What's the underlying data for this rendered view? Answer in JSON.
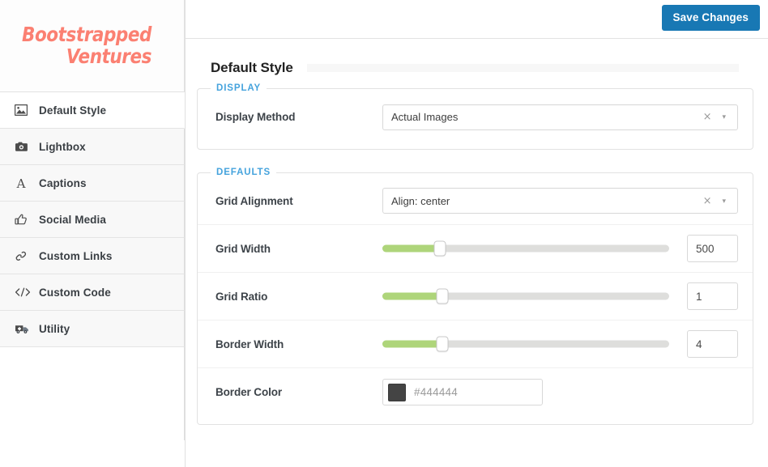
{
  "brand": {
    "line1": "Bootstrapped",
    "line2": "Ventures",
    "color": "#fb8072"
  },
  "sidebar": {
    "items": [
      {
        "label": "Default Style",
        "icon": "image-icon",
        "active": true
      },
      {
        "label": "Lightbox",
        "icon": "camera-icon",
        "active": false
      },
      {
        "label": "Captions",
        "icon": "letter-a-icon",
        "active": false
      },
      {
        "label": "Social Media",
        "icon": "thumbs-up-icon",
        "active": false
      },
      {
        "label": "Custom Links",
        "icon": "link-icon",
        "active": false
      },
      {
        "label": "Custom Code",
        "icon": "code-icon",
        "active": false
      },
      {
        "label": "Utility",
        "icon": "ambulance-icon",
        "active": false
      }
    ]
  },
  "topbar": {
    "save_label": "Save Changes",
    "save_color": "#1878b4"
  },
  "page": {
    "title": "Default Style"
  },
  "panels": [
    {
      "legend": "DISPLAY",
      "rows": [
        {
          "label": "Display Method",
          "type": "select",
          "value": "Actual Images",
          "clear_icon": "×",
          "caret_icon": "▾"
        }
      ]
    },
    {
      "legend": "DEFAULTS",
      "rows": [
        {
          "label": "Grid Alignment",
          "type": "select",
          "value": "Align: center",
          "clear_icon": "×",
          "caret_icon": "▾"
        },
        {
          "label": "Grid Width",
          "type": "slider",
          "value": "500",
          "percent": 20,
          "fill_color": "#aed57a"
        },
        {
          "label": "Grid Ratio",
          "type": "slider",
          "value": "1",
          "percent": 21,
          "fill_color": "#aed57a"
        },
        {
          "label": "Border Width",
          "type": "slider",
          "value": "4",
          "percent": 21,
          "fill_color": "#aed57a"
        },
        {
          "label": "Border Color",
          "type": "color",
          "value": "#444444",
          "swatch": "#444444"
        }
      ]
    }
  ]
}
